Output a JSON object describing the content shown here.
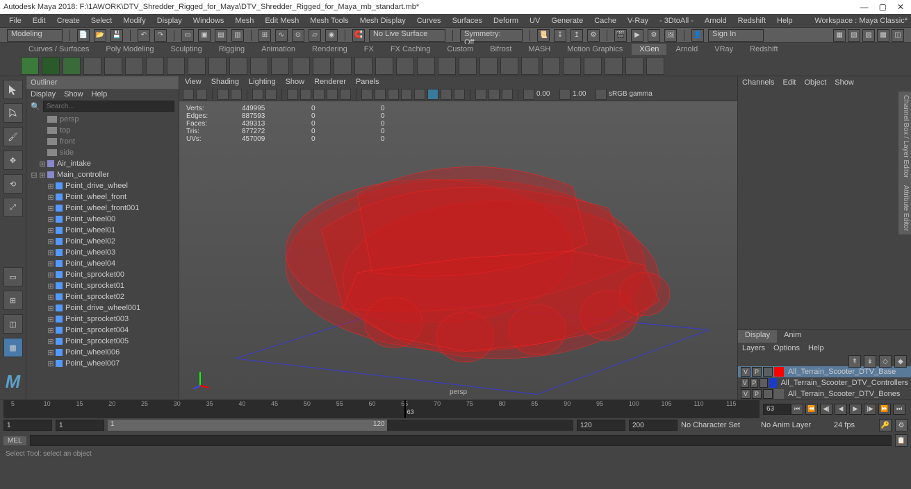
{
  "title": "Autodesk Maya 2018: F:\\1AWORK\\DTV_Shredder_Rigged_for_Maya\\DTV_Shredder_Rigged_for_Maya_mb_standart.mb*",
  "menubar": [
    "File",
    "Edit",
    "Create",
    "Select",
    "Modify",
    "Display",
    "Windows",
    "Mesh",
    "Edit Mesh",
    "Mesh Tools",
    "Mesh Display",
    "Curves",
    "Surfaces",
    "Deform",
    "UV",
    "Generate",
    "Cache",
    "V-Ray",
    "- 3DtoAll -",
    "Arnold",
    "Redshift",
    "Help"
  ],
  "workspace_label": "Workspace :",
  "workspace_value": "Maya Classic*",
  "statusline": {
    "mode": "Modeling",
    "no_live_surface": "No Live Surface",
    "symmetry": "Symmetry: Off",
    "signin": "Sign In"
  },
  "shelf_tabs": [
    "Curves / Surfaces",
    "Poly Modeling",
    "Sculpting",
    "Rigging",
    "Animation",
    "Rendering",
    "FX",
    "FX Caching",
    "Custom",
    "Bifrost",
    "MASH",
    "Motion Graphics",
    "XGen",
    "Arnold",
    "VRay",
    "Redshift"
  ],
  "shelf_active": "XGen",
  "outliner": {
    "title": "Outliner",
    "menu": [
      "Display",
      "Show",
      "Help"
    ],
    "search_placeholder": "Search...",
    "cameras": [
      "persp",
      "top",
      "front",
      "side"
    ],
    "air_intake": "Air_intake",
    "main_controller": "Main_controller",
    "nodes": [
      "Point_drive_wheel",
      "Point_wheel_front",
      "Point_wheel_front001",
      "Point_wheel00",
      "Point_wheel01",
      "Point_wheel02",
      "Point_wheel03",
      "Point_wheel04",
      "Point_sprocket00",
      "Point_sprocket01",
      "Point_sprocket02",
      "Point_drive_wheel001",
      "Point_sprocket003",
      "Point_sprocket004",
      "Point_sprocket005",
      "Point_wheel006",
      "Point_wheel007"
    ]
  },
  "viewport": {
    "menu": [
      "View",
      "Shading",
      "Lighting",
      "Show",
      "Renderer",
      "Panels"
    ],
    "hud": {
      "verts_label": "Verts:",
      "verts": "449995",
      "verts2": "0",
      "verts3": "0",
      "edges_label": "Edges:",
      "edges": "887593",
      "edges2": "0",
      "edges3": "0",
      "faces_label": "Faces:",
      "faces": "439313",
      "faces2": "0",
      "faces3": "0",
      "tris_label": "Tris:",
      "tris": "877272",
      "tris2": "0",
      "tris3": "0",
      "uvs_label": "UVs:",
      "uvs": "457009",
      "uvs2": "0",
      "uvs3": "0"
    },
    "persp_label": "persp",
    "exposure": "0.00",
    "gamma": "1.00",
    "colorspace": "sRGB gamma"
  },
  "channels": {
    "menu": [
      "Channels",
      "Edit",
      "Object",
      "Show"
    ]
  },
  "layers": {
    "tabs": [
      "Display",
      "Anim"
    ],
    "active_tab": "Display",
    "menu": [
      "Layers",
      "Options",
      "Help"
    ],
    "rows": [
      {
        "v": "V",
        "p": "P",
        "on": true,
        "color": "#ff0000",
        "name": "All_Terrain_Scooter_DTV_Base",
        "selected": true
      },
      {
        "v": "V",
        "p": "P",
        "on": true,
        "color": "#1a3ccc",
        "name": "All_Terrain_Scooter_DTV_Controllers",
        "selected": false
      },
      {
        "v": "V",
        "p": "P",
        "on": false,
        "color": "#5d5d5d",
        "name": "All_Terrain_Scooter_DTV_Bones",
        "selected": false
      }
    ]
  },
  "timeline": {
    "ticks": [
      5,
      10,
      15,
      20,
      25,
      30,
      35,
      40,
      45,
      50,
      55,
      60,
      65,
      70,
      75,
      80,
      85,
      90,
      95,
      100,
      105,
      110,
      115
    ],
    "current": "63",
    "current_indicator": "63"
  },
  "range": {
    "start_outer": "1",
    "start_inner": "1",
    "end_inner": "120",
    "end_outer": "120",
    "total": "200",
    "charset": "No Character Set",
    "animlayer": "No Anim Layer",
    "fps": "24 fps"
  },
  "cmdline": {
    "lang": "MEL"
  },
  "helpline": "Select Tool: select an object",
  "right_tabs": [
    "Channel Box / Layer Editor",
    "Attribute Editor"
  ]
}
